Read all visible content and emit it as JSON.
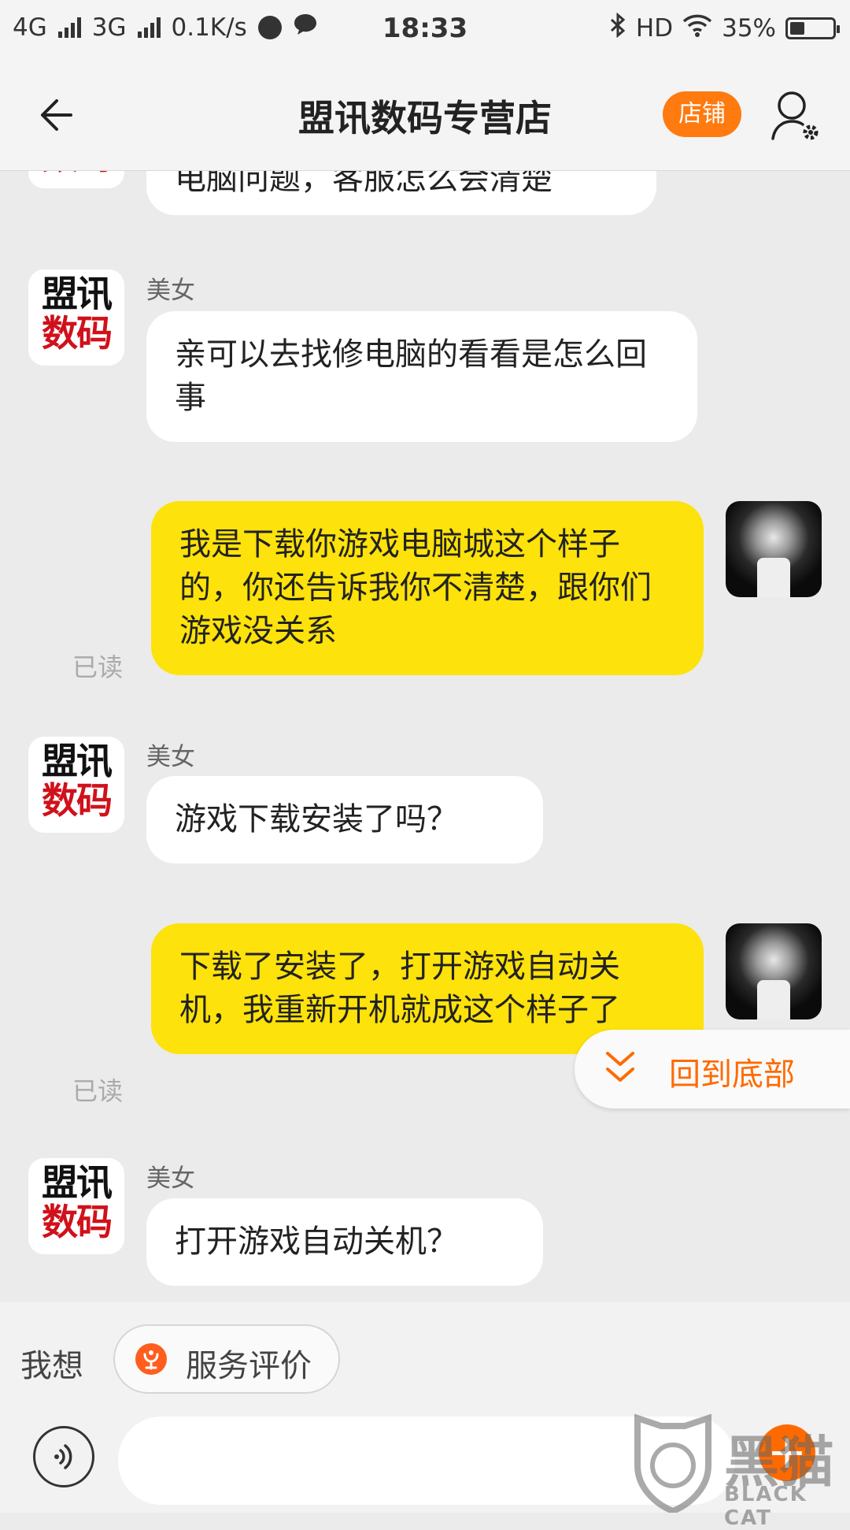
{
  "status_bar": {
    "network1": "4G",
    "network2": "3G",
    "speed": "0.1K/s",
    "time": "18:33",
    "hd": "HD",
    "battery_pct": "35%",
    "battery_level": 0.35
  },
  "header": {
    "title": "盟讯数码专营店",
    "shop_button": "店铺"
  },
  "shop_avatar": {
    "line1": "盟讯",
    "line2": "数码"
  },
  "messages": {
    "m0": {
      "text": "电脑问题，客服怎么会清楚"
    },
    "m1": {
      "sender": "美女",
      "text": "亲可以去找修电脑的看看是怎么回事"
    },
    "m2": {
      "text": "我是下载你游戏电脑城这个样子的，你还告诉我你不清楚，跟你们游戏没关系",
      "status": "已读"
    },
    "m3": {
      "sender": "美女",
      "text": "游戏下载安装了吗？"
    },
    "m4": {
      "text": "下载了安装了，打开游戏自动关机，我重新开机就成这个样子了",
      "status": "已读"
    },
    "m5": {
      "sender": "美女",
      "text": "打开游戏自动关机？"
    }
  },
  "jump_to_bottom": "回到底部",
  "quick_bar": {
    "label": "我想",
    "chip": "服务评价"
  },
  "input": {
    "placeholder": ""
  },
  "watermark": {
    "cn": "黑猫",
    "en": "BLACK CAT"
  },
  "colors": {
    "accent": "#ff6a00",
    "outgoing_bubble": "#fde20b",
    "incoming_bubble": "#ffffff",
    "background": "#ebebeb"
  }
}
